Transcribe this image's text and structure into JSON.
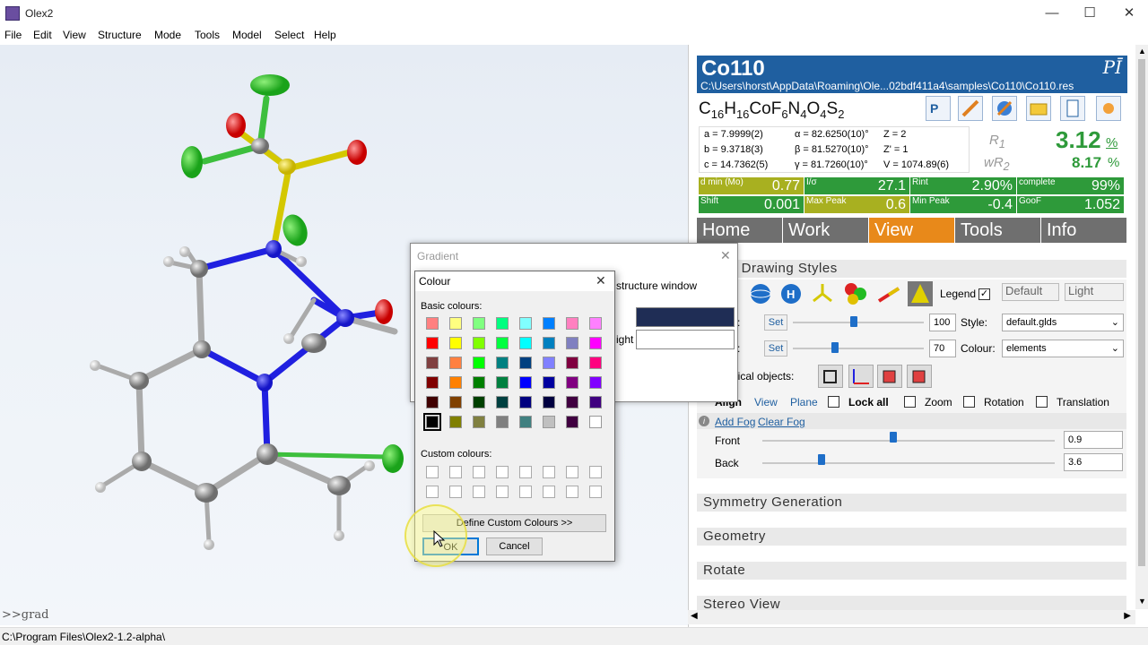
{
  "window": {
    "title": "Olex2",
    "minimize": "—",
    "maximize": "☐",
    "close": "✕"
  },
  "menu": [
    "File",
    "Edit",
    "View",
    "Structure",
    "Mode",
    "Tools",
    "Model",
    "Select",
    "Help"
  ],
  "command_line": ">>grad",
  "status_path": "C:\\Program Files\\Olex2-1.2-alpha\\",
  "structure": {
    "name": "Co110",
    "path": "C:\\Users\\horst\\AppData\\Roaming\\Ole...02bdf411a4\\samples\\Co110\\Co110.res",
    "logo": "PĪ",
    "formula": {
      "c": "C",
      "c_n": "16",
      "h": "H",
      "h_n": "16",
      "co": "CoF",
      "f_n": "6",
      "n": "N",
      "n_n": "4",
      "o": "O",
      "o_n": "4",
      "s": "S",
      "s_n": "2"
    }
  },
  "cell": {
    "a": "a = 7.9999(2)",
    "b": "b = 9.3718(3)",
    "c": "c = 14.7362(5)",
    "alpha": "α = 82.6250(10)°",
    "beta": "β = 81.5270(10)°",
    "gamma": "γ = 81.7260(10)°",
    "z": "Z = 2",
    "zp": "Z' = 1",
    "v": "V = 1074.89(6)"
  },
  "r_values": {
    "r1_label": "R",
    "r1_sub": "1",
    "r1_value": "3.12",
    "r1_unit": "%",
    "wr2_label": "wR",
    "wr2_sub": "2",
    "wr2_value": "8.17",
    "wr2_unit": "%"
  },
  "stats": [
    {
      "label": "d min (Mo)",
      "value": "0.77",
      "color": "#a8b020"
    },
    {
      "label": "I/σ",
      "value": "27.1",
      "color": "#2e9a3a"
    },
    {
      "label": "Rint",
      "value": "2.90%",
      "color": "#2e9a3a"
    },
    {
      "label": "complete",
      "value": "99%",
      "color": "#2e9a3a"
    },
    {
      "label": "Shift",
      "value": "0.001",
      "color": "#2e9a3a"
    },
    {
      "label": "Max Peak",
      "value": "0.6",
      "color": "#a8b020"
    },
    {
      "label": "Min Peak",
      "value": "-0.4",
      "color": "#2e9a3a"
    },
    {
      "label": "GooF",
      "value": "1.052",
      "color": "#2e9a3a"
    }
  ],
  "tabs": [
    "Home",
    "Work",
    "View",
    "Tools",
    "Info"
  ],
  "drawing": {
    "title": "k Drawing Styles",
    "legend": "Legend",
    "default_btn": "Default",
    "light_btn": "Light",
    "row1_label": "r:",
    "row1_set": "Set",
    "row1_value": "100",
    "style_label": "Style:",
    "style_value": "default.glds",
    "row2_label": "r:",
    "row2_set": "Set",
    "row2_value": "70",
    "colour_label": "Colour:",
    "colour_value": "elements",
    "graphical_label": "hical objects:",
    "align": "Align",
    "view": "View",
    "plane": "Plane",
    "lock_all": "Lock all",
    "zoom": "Zoom",
    "rotation": "Rotation",
    "translation": "Translation",
    "add_fog": "Add Fog",
    "clear_fog": "Clear Fog",
    "front_label": "Front",
    "front_value": "0.9",
    "back_label": "Back",
    "back_value": "3.6"
  },
  "sections": [
    "Symmetry Generation",
    "Geometry",
    "Rotate",
    "Stereo View"
  ],
  "gradient": {
    "title": "Gradient",
    "structure_window": "structure window",
    "ight": "ight",
    "top_colour": "#1f2d55"
  },
  "colour_dialog": {
    "title": "Colour",
    "basic": "Basic colours:",
    "custom": "Custom colours:",
    "define": "Define Custom Colours >>",
    "ok": "OK",
    "cancel": "Cancel",
    "basic_colours": [
      "#ff8080",
      "#ffff80",
      "#80ff80",
      "#00ff80",
      "#80ffff",
      "#0080ff",
      "#ff80c0",
      "#ff80ff",
      "#ff0000",
      "#ffff00",
      "#80ff00",
      "#00ff40",
      "#00ffff",
      "#0080c0",
      "#8080c0",
      "#ff00ff",
      "#804040",
      "#ff8040",
      "#00ff00",
      "#008080",
      "#004080",
      "#8080ff",
      "#800040",
      "#ff0080",
      "#800000",
      "#ff8000",
      "#008000",
      "#008040",
      "#0000ff",
      "#0000a0",
      "#800080",
      "#8000ff",
      "#400000",
      "#804000",
      "#004000",
      "#004040",
      "#000080",
      "#000040",
      "#400040",
      "#400080",
      "#000000",
      "#808000",
      "#808040",
      "#808080",
      "#408080",
      "#c0c0c0",
      "#400040",
      "#ffffff"
    ]
  }
}
